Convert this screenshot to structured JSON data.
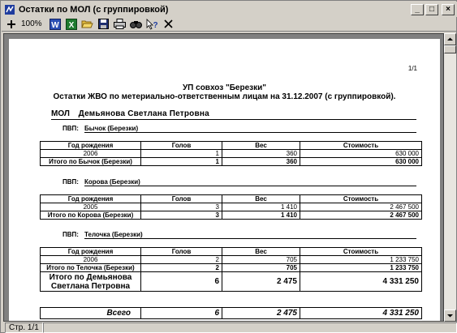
{
  "window": {
    "title": "Остатки по МОЛ (с группировкой)",
    "minimize_glyph": "_",
    "maximize_glyph": "□",
    "close_glyph": "×"
  },
  "toolbar": {
    "zoom_label": "100%",
    "icons": [
      "zoom-in-icon",
      "word-icon",
      "excel-icon",
      "open-folder-icon",
      "save-icon",
      "print-icon",
      "find-icon",
      "help-icon",
      "close-icon"
    ]
  },
  "status": {
    "page_text": "Стр. 1/1"
  },
  "report": {
    "page_number": "1/1",
    "organization": "УП совхоз \"Березки\"",
    "heading": "Остатки ЖВО по метериально-ответственным лицам на 31.12.2007 (с группировкой).",
    "mol_label": "МОЛ",
    "mol_name": "Демьянова  Светлана  Петровна",
    "columns": [
      "Год рождения",
      "Голов",
      "Вес",
      "Стоимость"
    ],
    "groups": [
      {
        "pvb_label": "ПВП:",
        "pvb_name": "Бычок (Березки)",
        "rows": [
          [
            "2006",
            "1",
            "360",
            "630 000"
          ]
        ],
        "total": [
          "Итого по Бычок (Березки)",
          "1",
          "360",
          "630 000"
        ]
      },
      {
        "pvb_label": "ПВП:",
        "pvb_name": "Корова (Березки)",
        "rows": [
          [
            "2005",
            "3",
            "1 410",
            "2 467 500"
          ]
        ],
        "total": [
          "Итого по Корова (Березки)",
          "3",
          "1 410",
          "2 467 500"
        ]
      },
      {
        "pvb_label": "ПВП:",
        "pvb_name": "Телочка (Березки)",
        "rows": [
          [
            "2006",
            "2",
            "705",
            "1 233 750"
          ]
        ],
        "total": [
          "Итого по Телочка (Березки)",
          "2",
          "705",
          "1 233 750"
        ]
      }
    ],
    "mol_total": [
      "Итого по Демьянова Светлана  Петровна",
      "6",
      "2 475",
      "4 331 250"
    ],
    "grand_total": [
      "Всего",
      "6",
      "2 475",
      "4 331 250"
    ]
  }
}
